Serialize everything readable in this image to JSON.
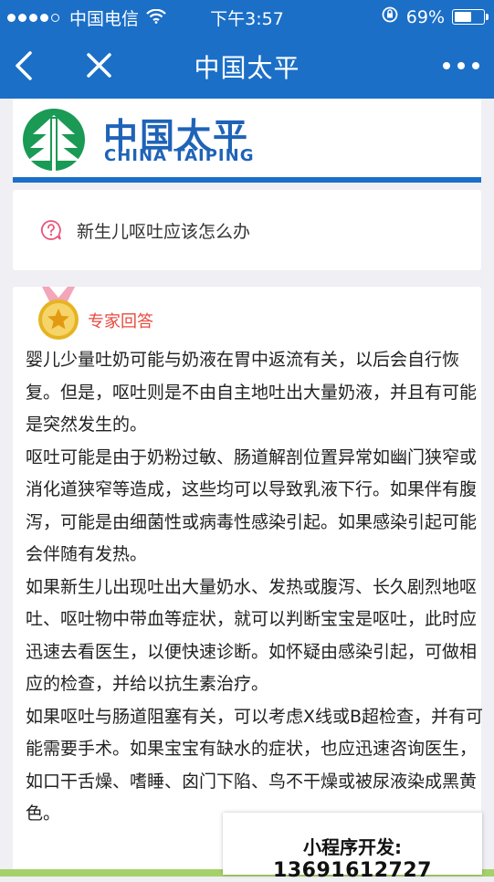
{
  "status_bar": {
    "carrier": "中国电信",
    "time": "下午3:57",
    "battery_percent": "69%",
    "battery_level": 0.69,
    "signal_dots_filled": 4,
    "signal_dots_total": 5
  },
  "nav": {
    "title": "中国太平",
    "back_icon": "chevron-left-icon",
    "close_icon": "close-icon",
    "more_icon": "more-horizontal-icon"
  },
  "logo": {
    "name_cn": "中国太平",
    "name_en": "CHINA TAIPING"
  },
  "question": {
    "icon": "question-bubble-icon",
    "text": "新生儿呕吐应该怎么办"
  },
  "answer": {
    "badge_icon": "medal-star-icon",
    "label": "专家回答",
    "paragraphs": [
      "婴儿少量吐奶可能与奶液在胃中返流有关，以后会自行恢复。但是，呕吐则是不由自主地吐出大量奶液，并且有可能是突然发生的。",
      "呕吐可能是由于奶粉过敏、肠道解剖位置异常如幽门狭窄或消化道狭窄等造成，这些均可以导致乳液下行。如果伴有腹泻，可能是由细菌性或病毒性感染引起。如果感染引起可能会伴随有发热。",
      "如果新生儿出现吐出大量奶水、发热或腹泻、长久剧烈地呕吐、呕吐物中带血等症状，就可以判断宝宝是呕吐，此时应迅速去看医生，以便快速诊断。如怀疑由感染引起，可做相应的检查，并给以抗生素治疗。",
      "如果呕吐与肠道阻塞有关，可以考虑X线或B超检查，并有可能需要手术。如果宝宝有缺水的症状，也应迅速咨询医生，如口干舌燥、嗜睡、囟门下陷、鸟不干燥或被尿液染成黑黄色。"
    ]
  },
  "promo": {
    "label": "小程序开发:",
    "phone": "13691612727"
  },
  "colors": {
    "brand_blue": "#1b6fc7",
    "expert_red": "#e8493c",
    "question_pink": "#e8577a",
    "medal_gold": "#e6b422",
    "logo_green": "#1a9a55"
  }
}
